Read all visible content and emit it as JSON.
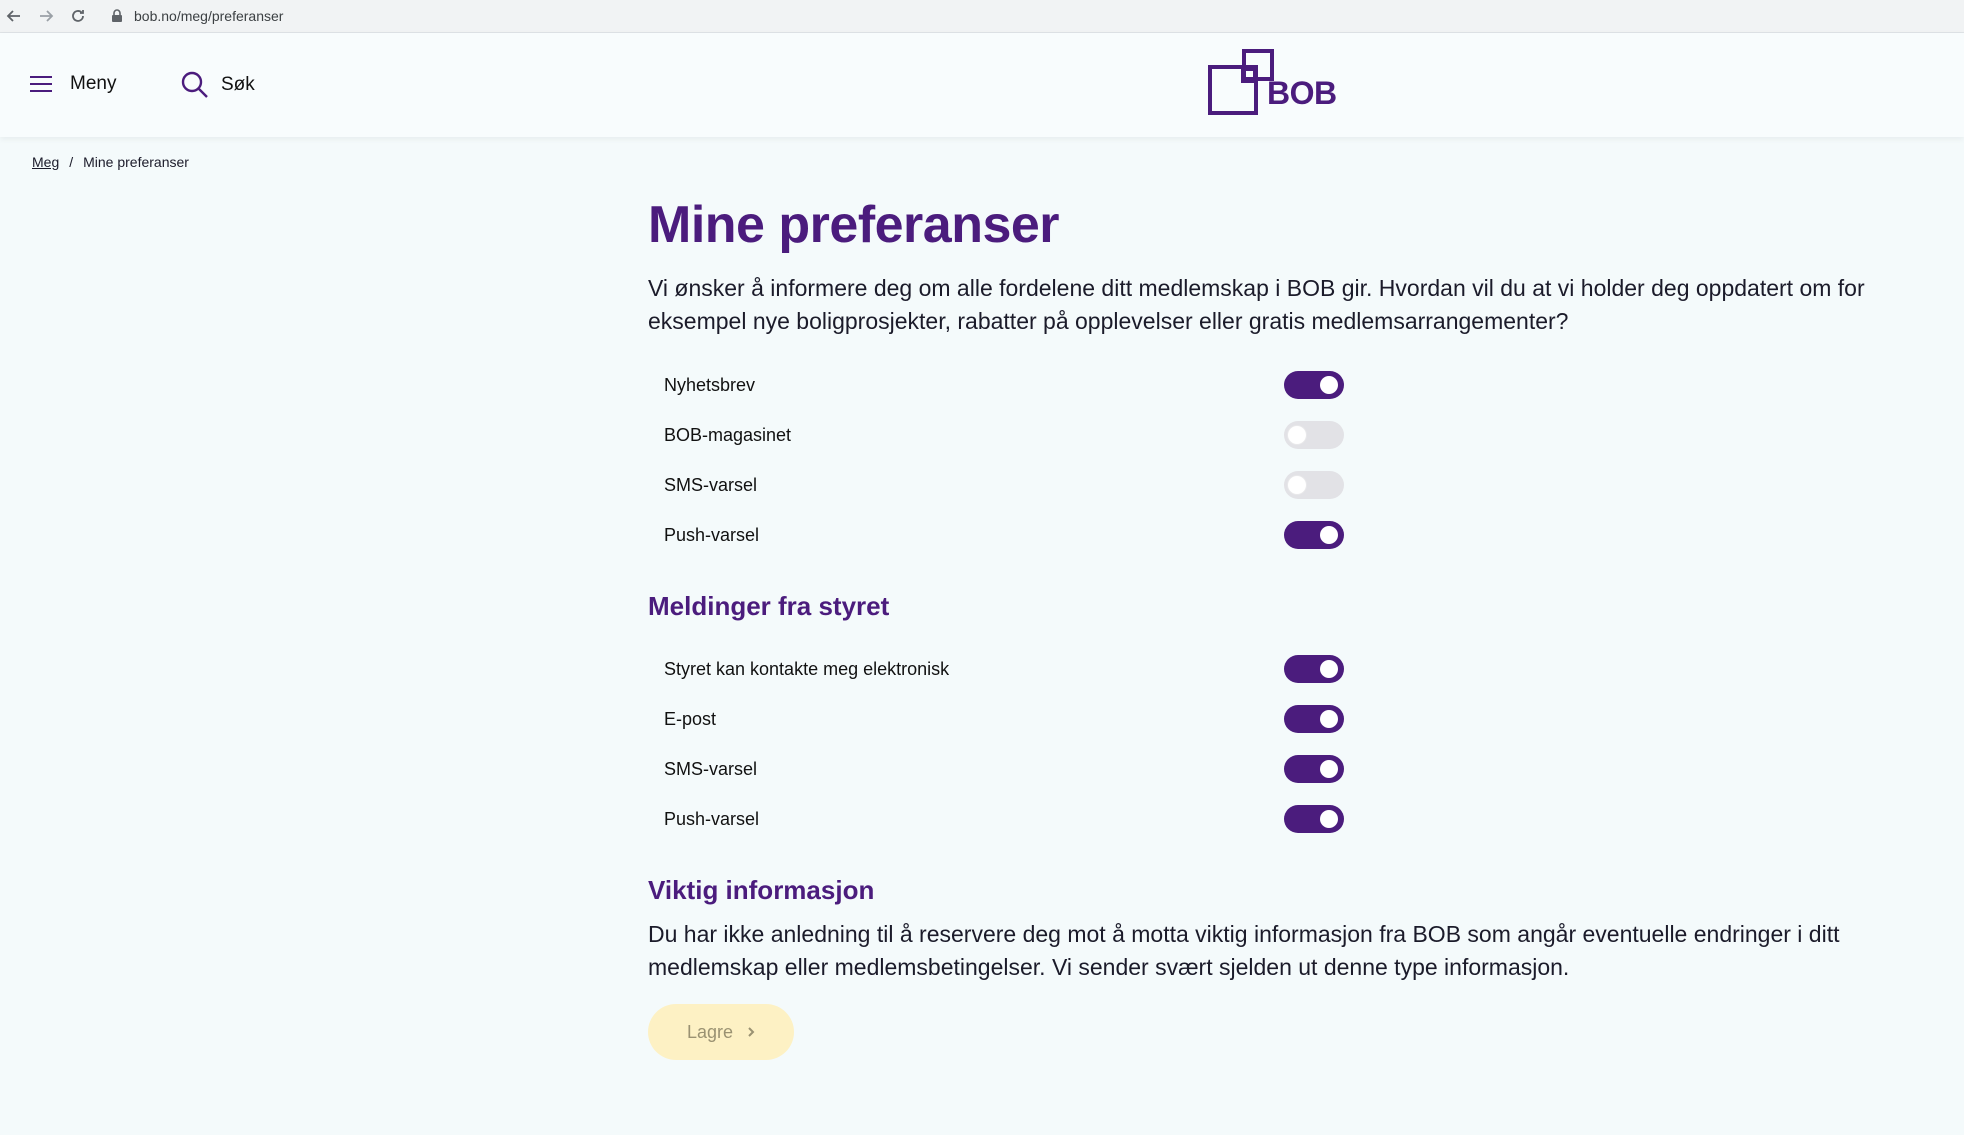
{
  "browser": {
    "url": "bob.no/meg/preferanser"
  },
  "header": {
    "menu_label": "Meny",
    "search_label": "Søk",
    "logo_text": "BOB"
  },
  "breadcrumb": {
    "items": [
      "Meg",
      "Mine preferanser"
    ],
    "separator": "/"
  },
  "main": {
    "title": "Mine preferanser",
    "intro": "Vi ønsker å informere deg om alle fordelene ditt medlemskap i BOB gir. Hvordan vil du at vi holder deg oppdatert om for eksempel nye boligprosjekter, rabatter på opplevelser eller gratis medlemsarrangementer?",
    "preferences": [
      {
        "label": "Nyhetsbrev",
        "on": true
      },
      {
        "label": "BOB-magasinet",
        "on": false
      },
      {
        "label": "SMS-varsel",
        "on": false
      },
      {
        "label": "Push-varsel",
        "on": true
      }
    ],
    "board_section": {
      "title": "Meldinger fra styret",
      "items": [
        {
          "label": "Styret kan kontakte meg elektronisk",
          "on": true
        },
        {
          "label": "E-post",
          "on": true
        },
        {
          "label": "SMS-varsel",
          "on": true
        },
        {
          "label": "Push-varsel",
          "on": true
        }
      ]
    },
    "important_section": {
      "title": "Viktig informasjon",
      "text": "Du har ikke anledning til å reservere deg mot å motta viktig informasjon fra BOB som angår eventuelle endringer i ditt medlemskap eller medlemsbetingelser. Vi sender svært sjelden ut denne type informasjon."
    },
    "save_label": "Lagre"
  },
  "colors": {
    "brand_purple": "#4b1c7d",
    "toggle_off": "#e2e2e6",
    "save_button_bg": "#fdf1c4"
  }
}
